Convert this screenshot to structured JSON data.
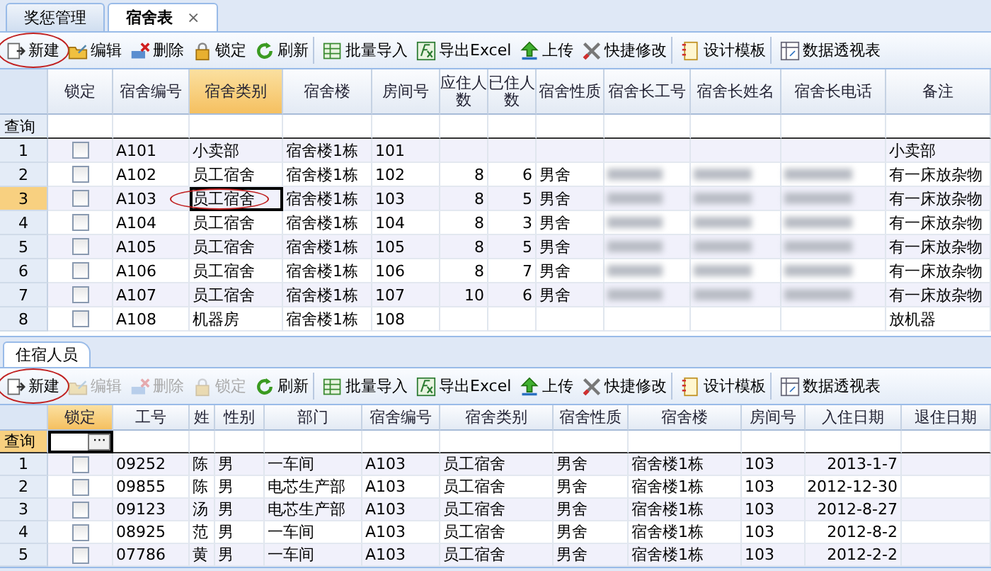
{
  "tabs": [
    {
      "label": "奖惩管理",
      "selected": false
    },
    {
      "label": "宿舍表",
      "selected": true,
      "close": "×"
    }
  ],
  "top_toolbar": [
    {
      "label": "新建",
      "disabled": false,
      "circled": true,
      "separator_after": false
    },
    {
      "label": "编辑",
      "disabled": false,
      "circled": false,
      "separator_after": false
    },
    {
      "label": "删除",
      "disabled": false,
      "circled": false,
      "separator_after": false
    },
    {
      "label": "锁定",
      "disabled": false,
      "circled": false,
      "separator_after": false
    },
    {
      "label": "刷新",
      "disabled": false,
      "circled": false,
      "separator_after": true
    },
    {
      "label": "批量导入",
      "disabled": false,
      "circled": false,
      "separator_after": false
    },
    {
      "label": "导出Excel",
      "disabled": false,
      "circled": false,
      "separator_after": false
    },
    {
      "label": "上传",
      "disabled": false,
      "circled": false,
      "separator_after": false
    },
    {
      "label": "快捷修改",
      "disabled": false,
      "circled": false,
      "separator_after": true
    },
    {
      "label": "设计模板",
      "disabled": false,
      "circled": false,
      "separator_after": true
    },
    {
      "label": "数据透视表",
      "disabled": false,
      "circled": false,
      "separator_after": false
    }
  ],
  "top_table": {
    "columns": [
      {
        "label": "锁定",
        "selected": false
      },
      {
        "label": "宿舍编号",
        "selected": false
      },
      {
        "label": "宿舍类别",
        "selected": true
      },
      {
        "label": "宿舍楼",
        "selected": false
      },
      {
        "label": "房间号",
        "selected": false
      },
      {
        "label": "应住人数",
        "selected": false
      },
      {
        "label": "已住人数",
        "selected": false
      },
      {
        "label": "宿舍性质",
        "selected": false
      },
      {
        "label": "宿舍长工号",
        "selected": false
      },
      {
        "label": "宿舍长姓名",
        "selected": false
      },
      {
        "label": "宿舍长电话",
        "selected": false
      },
      {
        "label": "备注",
        "selected": false
      }
    ],
    "query": {
      "label": "查询",
      "selected": false,
      "focused_filter": false
    },
    "rows": [
      {
        "no": "1",
        "selected": false,
        "cells": [
          {
            "checked": false
          },
          "A101",
          "小卖部",
          "宿舍楼1栋",
          "101",
          "",
          "",
          "",
          "",
          "",
          "",
          "小卖部"
        ]
      },
      {
        "no": "2",
        "selected": false,
        "cells": [
          {
            "checked": false
          },
          "A102",
          "员工宿舍",
          "宿舍楼1栋",
          "102",
          "8",
          "6",
          "男舍",
          {
            "blurred": true
          },
          {
            "blurred": true
          },
          {
            "blurred": true
          },
          "有一床放杂物"
        ]
      },
      {
        "no": "3",
        "selected": true,
        "cells": [
          {
            "checked": false
          },
          "A103",
          {
            "text": "员工宿舍",
            "focused": true,
            "circled": true
          },
          "宿舍楼1栋",
          "103",
          "8",
          "5",
          "男舍",
          {
            "blurred": true
          },
          {
            "blurred": true
          },
          {
            "blurred": true
          },
          "有一床放杂物"
        ]
      },
      {
        "no": "4",
        "selected": false,
        "cells": [
          {
            "checked": false
          },
          "A104",
          "员工宿舍",
          "宿舍楼1栋",
          "104",
          "8",
          "3",
          "男舍",
          {
            "blurred": true
          },
          {
            "blurred": true
          },
          {
            "blurred": true
          },
          "有一床放杂物"
        ]
      },
      {
        "no": "5",
        "selected": false,
        "cells": [
          {
            "checked": false
          },
          "A105",
          "员工宿舍",
          "宿舍楼1栋",
          "105",
          "8",
          "5",
          "男舍",
          {
            "blurred": true
          },
          {
            "blurred": true
          },
          {
            "blurred": true
          },
          "有一床放杂物"
        ]
      },
      {
        "no": "6",
        "selected": false,
        "cells": [
          {
            "checked": false
          },
          "A106",
          "员工宿舍",
          "宿舍楼1栋",
          "106",
          "8",
          "7",
          "男舍",
          {
            "blurred": true
          },
          {
            "blurred": true
          },
          {
            "blurred": true
          },
          "有一床放杂物"
        ]
      },
      {
        "no": "7",
        "selected": false,
        "cells": [
          {
            "checked": false
          },
          "A107",
          "员工宿舍",
          "宿舍楼1栋",
          "107",
          "10",
          "6",
          "男舍",
          {
            "blurred": true
          },
          {
            "blurred": true
          },
          {
            "blurred": true
          },
          "有一床放杂物"
        ]
      },
      {
        "no": "8",
        "selected": false,
        "cells": [
          {
            "checked": false
          },
          "A108",
          "机器房",
          "宿舍楼1栋",
          "108",
          "",
          "",
          "",
          "",
          "",
          "",
          "放机器"
        ]
      }
    ]
  },
  "panel_tab": {
    "label": "住宿人员",
    "selected": true
  },
  "bottom_toolbar": [
    {
      "label": "新建",
      "disabled": false,
      "circled": true,
      "separator_after": false
    },
    {
      "label": "编辑",
      "disabled": true,
      "circled": false,
      "separator_after": false
    },
    {
      "label": "删除",
      "disabled": true,
      "circled": false,
      "separator_after": false
    },
    {
      "label": "锁定",
      "disabled": true,
      "circled": false,
      "separator_after": false
    },
    {
      "label": "刷新",
      "disabled": false,
      "circled": false,
      "separator_after": true
    },
    {
      "label": "批量导入",
      "disabled": false,
      "circled": false,
      "separator_after": false
    },
    {
      "label": "导出Excel",
      "disabled": false,
      "circled": false,
      "separator_after": false
    },
    {
      "label": "上传",
      "disabled": false,
      "circled": false,
      "separator_after": false
    },
    {
      "label": "快捷修改",
      "disabled": false,
      "circled": false,
      "separator_after": true
    },
    {
      "label": "设计模板",
      "disabled": false,
      "circled": false,
      "separator_after": true
    },
    {
      "label": "数据透视表",
      "disabled": false,
      "circled": false,
      "separator_after": false
    }
  ],
  "bottom_table": {
    "columns": [
      {
        "label": "锁定",
        "selected": true
      },
      {
        "label": "工号",
        "selected": false
      },
      {
        "label": "姓",
        "selected": false
      },
      {
        "label": "性别",
        "selected": false
      },
      {
        "label": "部门",
        "selected": false
      },
      {
        "label": "宿舍编号",
        "selected": false
      },
      {
        "label": "宿舍类别",
        "selected": false
      },
      {
        "label": "宿舍性质",
        "selected": false
      },
      {
        "label": "宿舍楼",
        "selected": false
      },
      {
        "label": "房间号",
        "selected": false
      },
      {
        "label": "入住日期",
        "selected": false
      },
      {
        "label": "退住日期",
        "selected": false
      }
    ],
    "query": {
      "label": "查询",
      "selected": true,
      "focused_filter": true,
      "filter_button": "···"
    },
    "rows": [
      {
        "no": "1",
        "selected": false,
        "cells": [
          {
            "checked": false
          },
          "09252",
          "陈",
          "男",
          "一车间",
          "A103",
          "员工宿舍",
          "男舍",
          "宿舍楼1栋",
          "103",
          "2013-1-7",
          ""
        ]
      },
      {
        "no": "2",
        "selected": false,
        "cells": [
          {
            "checked": false
          },
          "09855",
          "陈",
          "男",
          "电芯生产部",
          "A103",
          "员工宿舍",
          "男舍",
          "宿舍楼1栋",
          "103",
          "2012-12-30",
          ""
        ]
      },
      {
        "no": "3",
        "selected": false,
        "cells": [
          {
            "checked": false
          },
          "09123",
          "汤",
          "男",
          "电芯生产部",
          "A103",
          "员工宿舍",
          "男舍",
          "宿舍楼1栋",
          "103",
          "2012-8-27",
          ""
        ]
      },
      {
        "no": "4",
        "selected": false,
        "cells": [
          {
            "checked": false
          },
          "08925",
          "范",
          "男",
          "一车间",
          "A103",
          "员工宿舍",
          "男舍",
          "宿舍楼1栋",
          "103",
          "2012-8-2",
          ""
        ]
      },
      {
        "no": "5",
        "selected": false,
        "cells": [
          {
            "checked": false
          },
          "07786",
          "黄",
          "男",
          "一车间",
          "A103",
          "员工宿舍",
          "男舍",
          "宿舍楼1栋",
          "103",
          "2012-2-2",
          ""
        ]
      }
    ]
  }
}
